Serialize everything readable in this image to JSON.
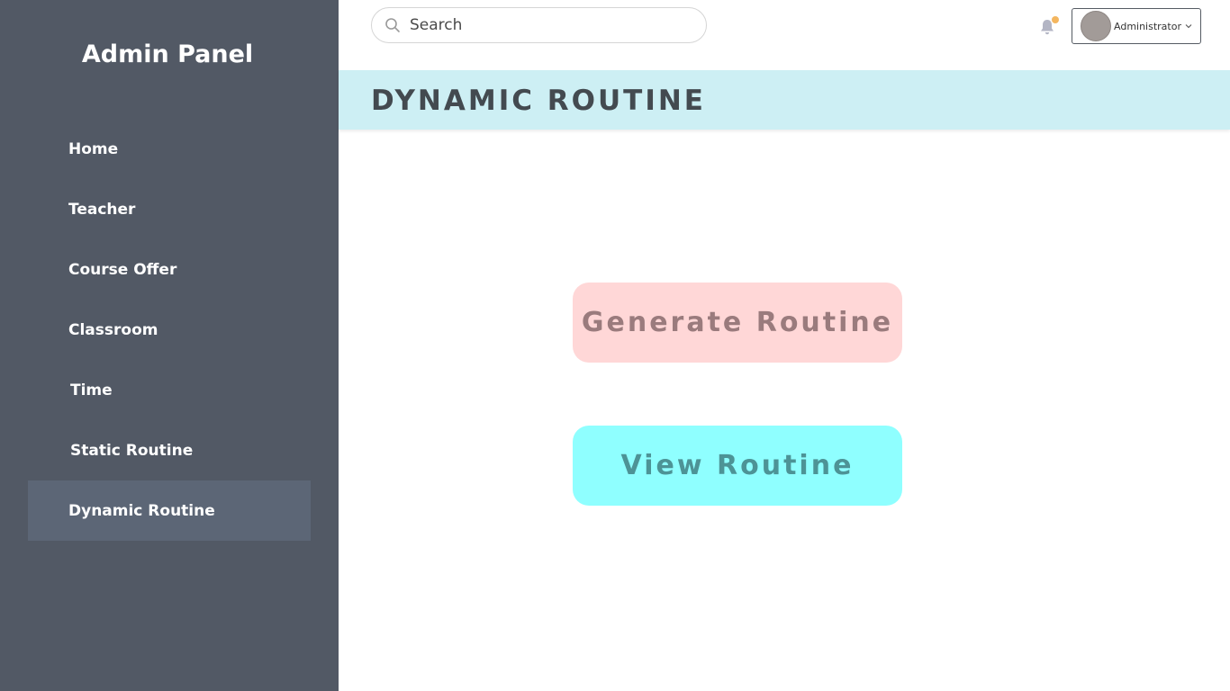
{
  "sidebar": {
    "brand": "Admin Panel",
    "items": [
      {
        "label": "Home",
        "active": false
      },
      {
        "label": "Teacher",
        "active": false
      },
      {
        "label": "Course Offer",
        "active": false
      },
      {
        "label": "Classroom",
        "active": false
      },
      {
        "label": "Time",
        "active": false
      },
      {
        "label": "Static Routine",
        "active": false
      },
      {
        "label": "Dynamic Routine",
        "active": true
      }
    ]
  },
  "header": {
    "search_placeholder": "Search",
    "user_name": "Administrator",
    "notification_dot_color": "#f4b65f"
  },
  "page": {
    "title": "DYNAMIC ROUTINE"
  },
  "actions": {
    "generate_label": "Generate Routine",
    "view_label": "View Routine"
  },
  "colors": {
    "sidebar_bg": "#525965",
    "sidebar_active": "#5c6676",
    "banner_bg": "#cdeff4",
    "generate_bg": "#ffd7d7",
    "view_bg": "#8fffff"
  }
}
